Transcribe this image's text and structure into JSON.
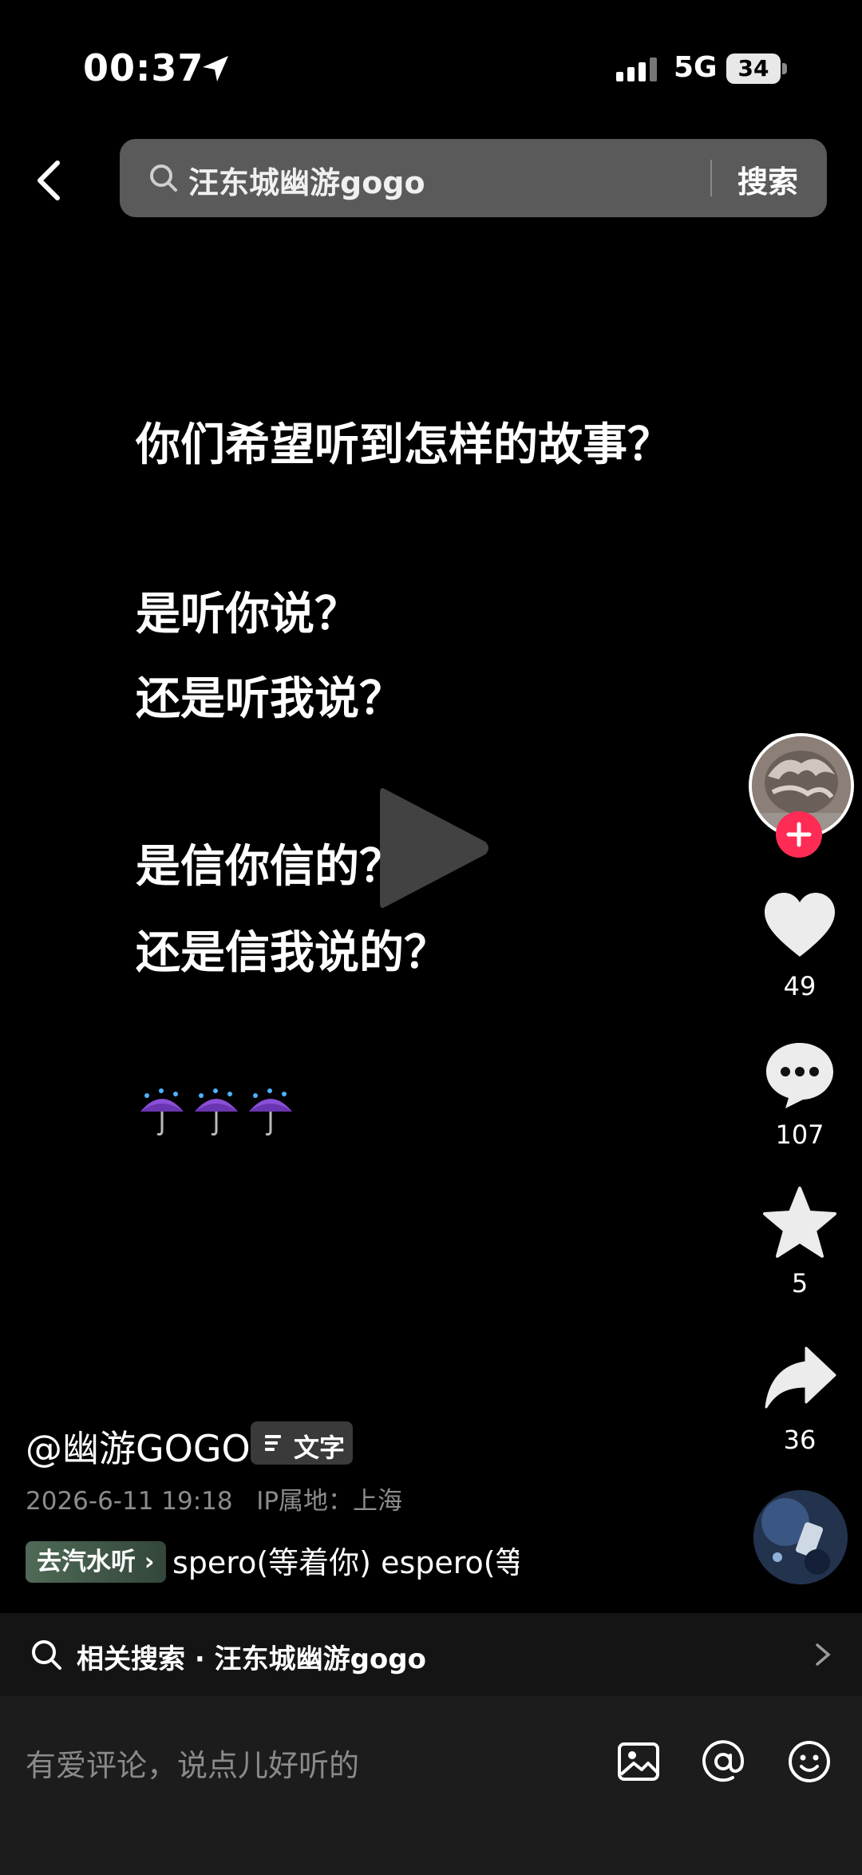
{
  "status_bar": {
    "time": "00:37",
    "network": "5G",
    "battery": "34"
  },
  "search": {
    "query": "汪东城幽游gogo",
    "button": "搜索"
  },
  "post": {
    "lines": [
      "你们希望听到怎样的故事？",
      "是听你说？",
      "还是听我说？",
      "是信你信的？",
      "还是信我说的？"
    ],
    "emoji": [
      "umbrella-rain",
      "umbrella-rain",
      "umbrella-rain"
    ]
  },
  "actions": {
    "likes": "49",
    "comments": "107",
    "favorites": "5",
    "shares": "36"
  },
  "author": {
    "handle": "@幽游GOGO",
    "type_tag": "文字"
  },
  "meta": {
    "date": "2026-6-11 19:18",
    "ip": "IP属地：上海"
  },
  "music": {
    "button": "去汽水听 ›",
    "title": "spero(等着你)   espero(等"
  },
  "related": {
    "text": "相关搜索 · 汪东城幽游gogo"
  },
  "comment": {
    "placeholder": "有爱评论，说点儿好听的"
  },
  "colors": {
    "accent": "#fe2c55",
    "background": "#000000",
    "searchbar": "#5a5a5a"
  }
}
